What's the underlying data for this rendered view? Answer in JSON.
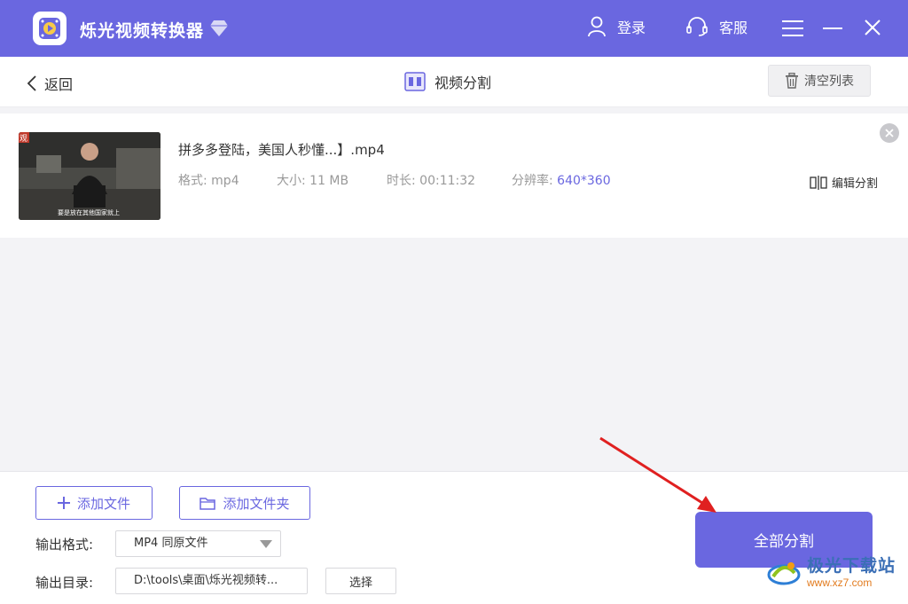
{
  "app": {
    "title": "烁光视频转换器"
  },
  "titlebar": {
    "login_label": "登录",
    "service_label": "客服"
  },
  "header": {
    "back_label": "返回",
    "page_title": "视频分割",
    "clear_label": "清空列表"
  },
  "file": {
    "name": "拼多多登陆，美国人秒懂...】.mp4",
    "format_label": "格式:",
    "format_value": "mp4",
    "size_label": "大小:",
    "size_value": "11 MB",
    "duration_label": "时长:",
    "duration_value": "00:11:32",
    "resolution_label": "分辨率:",
    "resolution_value": "640*360",
    "edit_split_label": "编辑分割",
    "thumbnail_caption": "要是放在其他国家就上",
    "thumbnail_badge": "观"
  },
  "bottom": {
    "add_file_label": "添加文件",
    "add_folder_label": "添加文件夹",
    "output_format_label": "输出格式:",
    "output_format_value": "MP4 同原文件",
    "output_dir_label": "输出目录:",
    "output_dir_value": "D:\\tools\\桌面\\烁光视频转...",
    "choose_label": "选择",
    "split_all_label": "全部分割"
  },
  "watermark": {
    "title": "极光下载站",
    "url": "www.xz7.com"
  },
  "colors": {
    "accent": "#6a67e0",
    "arrow": "#e02020"
  }
}
